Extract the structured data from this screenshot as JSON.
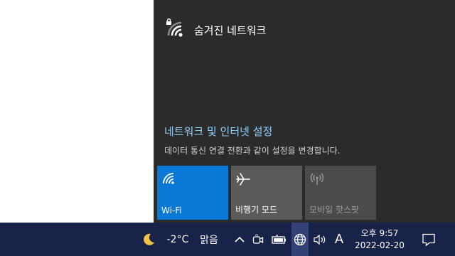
{
  "flyout": {
    "network_name": "숨겨진 네트워크",
    "settings_link": "네트워크 및 인터넷 설정",
    "settings_desc": "데이터 통신 연결 전환과 같이 설정을 변경합니다.",
    "tiles": [
      {
        "label": "Wi-Fi",
        "icon": "wifi-icon",
        "state": "on"
      },
      {
        "label": "비행기 모드",
        "icon": "airplane-icon",
        "state": "off"
      },
      {
        "label": "모바일 핫스팟",
        "icon": "hotspot-icon",
        "state": "disabled"
      }
    ]
  },
  "taskbar": {
    "weather_icon": "moon-icon",
    "temperature": "-2°C",
    "weather": "맑음",
    "ime": "A",
    "time": "오후 9:57",
    "date": "2022-02-20"
  },
  "colors": {
    "accent": "#0a78d7",
    "flyout_bg": "#2b2b2b",
    "taskbar_bg": "#19234a",
    "link": "#8fd0ff"
  }
}
